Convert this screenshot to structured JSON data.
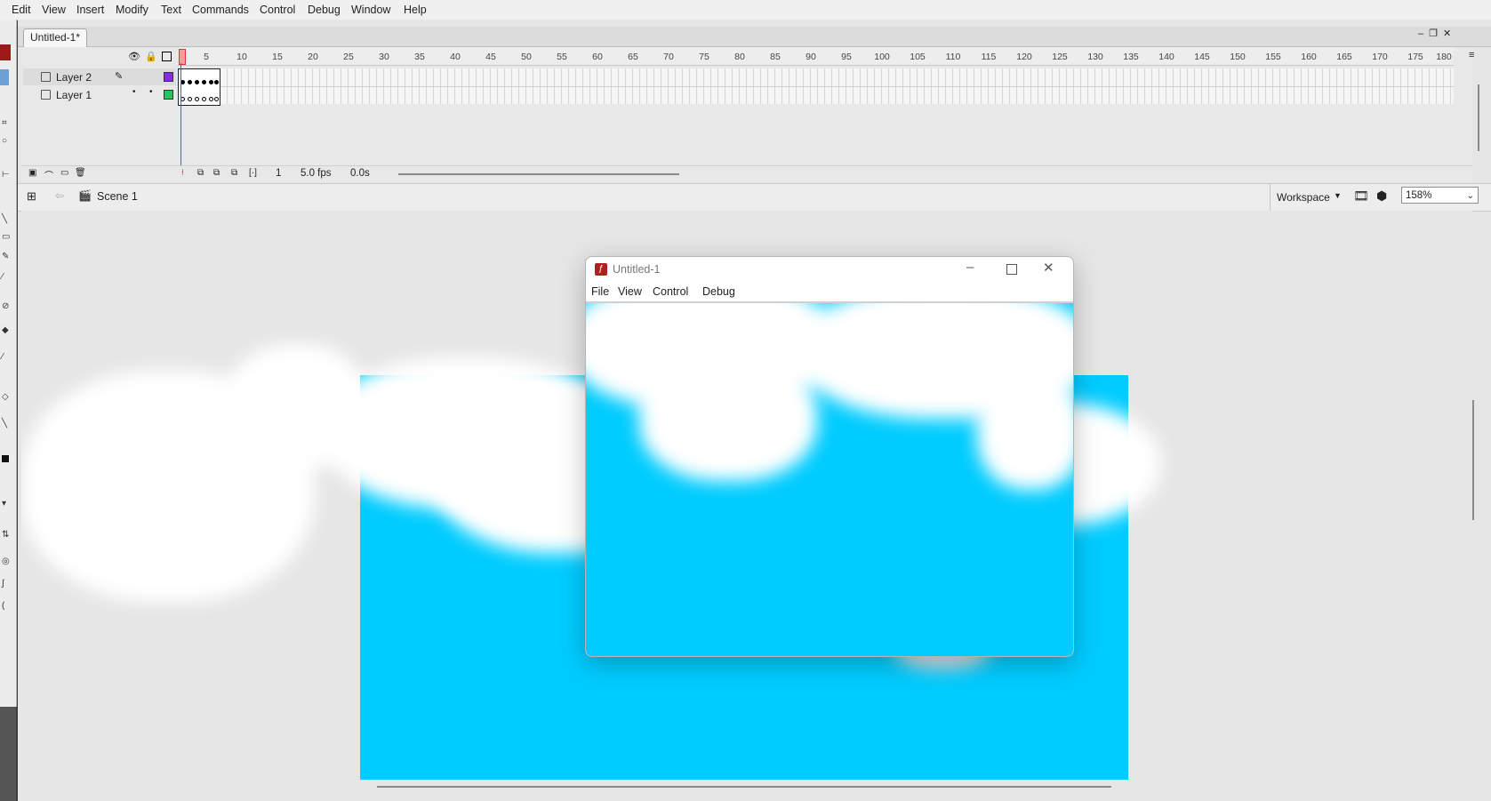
{
  "menubar": {
    "items": [
      "Edit",
      "View",
      "Insert",
      "Modify",
      "Text",
      "Commands",
      "Control",
      "Debug",
      "Window",
      "Help"
    ]
  },
  "document": {
    "tab_title": "Untitled-1*"
  },
  "timeline": {
    "ruler_numbers": [
      "5",
      "10",
      "15",
      "20",
      "25",
      "30",
      "35",
      "40",
      "45",
      "50",
      "55",
      "60",
      "65",
      "70",
      "75",
      "80",
      "85",
      "90",
      "95",
      "100",
      "105",
      "110",
      "115",
      "120",
      "125",
      "130",
      "135",
      "140",
      "145",
      "150",
      "155",
      "160",
      "165",
      "170",
      "175",
      "180"
    ],
    "layers": [
      {
        "name": "Layer 2",
        "color": "#8a2be2"
      },
      {
        "name": "Layer 1",
        "color": "#22c55e"
      }
    ],
    "status": {
      "frame": "1",
      "fps": "5.0 fps",
      "time": "0.0s"
    }
  },
  "editbar": {
    "scene": "Scene 1",
    "workspace": "Workspace",
    "zoom": "158%"
  },
  "player": {
    "title": "Untitled-1",
    "menu": [
      "File",
      "View",
      "Control",
      "Debug"
    ]
  },
  "colors": {
    "sky": "#00ccff",
    "cloud": "#ffffff",
    "stage_bg": "#e6e6e6"
  }
}
